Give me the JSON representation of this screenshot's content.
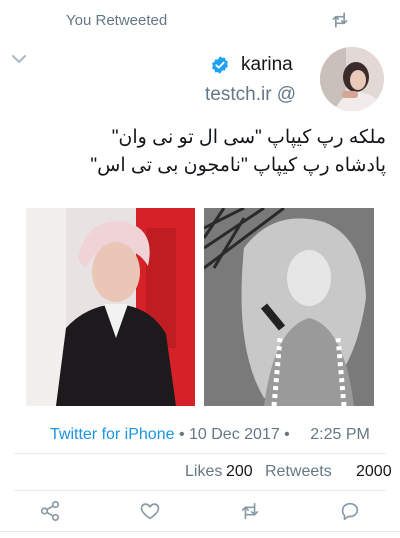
{
  "header": {
    "retweet_label": "You Retweeted"
  },
  "author": {
    "name": "karina",
    "handle": "testch.ir @",
    "verified": true
  },
  "tweet": {
    "lines": [
      "ملکه رپ کیپاپ \"سی ال تو نی وان\"",
      "پادشاه رپ کیپاپ \"نامجون بی تی اس\""
    ]
  },
  "meta": {
    "client": "Twitter for iPhone",
    "date": "• 10 Dec 2017 •",
    "time": "2:25 PM"
  },
  "stats": {
    "likes_label": "Likes",
    "likes_count": "200",
    "retweets_label": "Retweets",
    "retweets_count": "2000"
  },
  "icons": {
    "retweet_top": "retweet-icon",
    "chevron": "chevron-down-icon",
    "verified": "verified-badge-icon",
    "share": "share-icon",
    "like": "heart-icon",
    "retweet": "retweet-icon",
    "reply": "reply-icon"
  },
  "colors": {
    "link": "#1b95e0",
    "muted": "#657786",
    "verified": "#1da1f2"
  }
}
